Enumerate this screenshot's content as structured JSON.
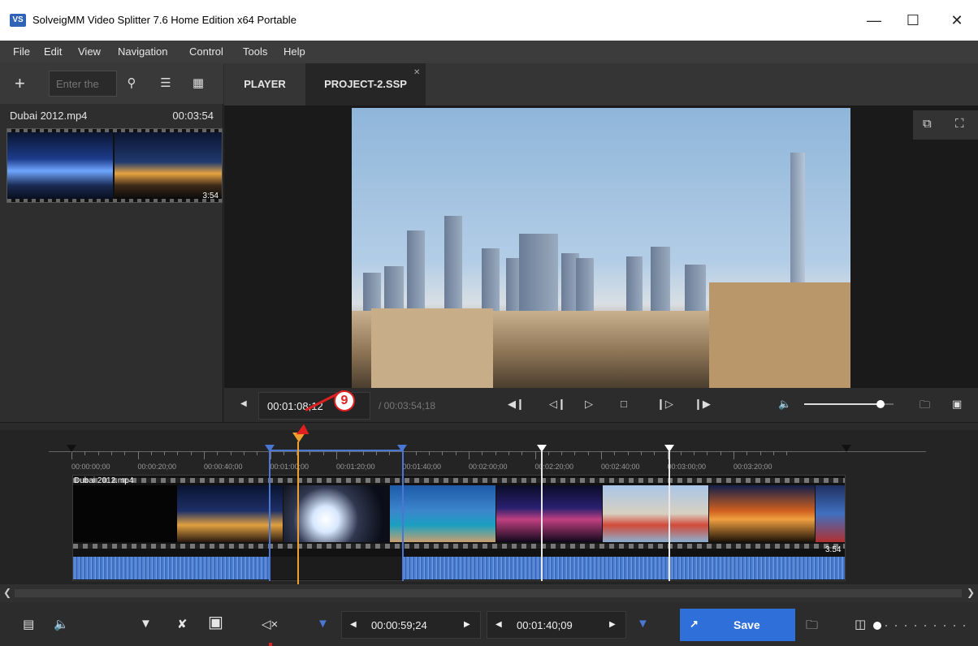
{
  "window": {
    "icon_label": "VS",
    "title": "SolveigMM Video Splitter 7.6 Home Edition x64 Portable",
    "minimize_icon": "minimize-icon",
    "maximize_icon": "maximize-icon",
    "close_icon": "close-icon"
  },
  "menu": [
    "File",
    "Edit",
    "View",
    "Navigation",
    "Control",
    "Tools",
    "Help"
  ],
  "library": {
    "search_placeholder": "Enter the",
    "clip": {
      "name": "Dubai 2012.mp4",
      "duration": "00:03:54",
      "thumb_duration": "3:54"
    }
  },
  "tabs": [
    {
      "label": "PLAYER",
      "active": false
    },
    {
      "label": "PROJECT-2.SSP",
      "active": true
    }
  ],
  "player": {
    "current_time": "00:01:08;12",
    "total_time": "/ 00:03:54;18",
    "volume": 0.85
  },
  "timeline": {
    "ruler_labels": [
      "00:00:00;00",
      "00:00:20;00",
      "00:00:40;00",
      "00:01:00;00",
      "00:01:20;00",
      "00:01:40;00",
      "00:02:00;00",
      "00:02:20;00",
      "00:02:40;00",
      "00:03:00;00",
      "00:03:20;00"
    ],
    "clip_title": "Dubai 2012.mp4",
    "clip_duration": "3:54",
    "callout_number": "9",
    "colors": {
      "selection": "#4a76d4",
      "playhead": "#f0a030",
      "marker": "#ffffff",
      "audio": "#5b8be0"
    }
  },
  "bottom": {
    "start_time": "00:00:59;24",
    "end_time": "00:01:40;09",
    "save_label": "Save",
    "accent": "#2f6fd9"
  }
}
